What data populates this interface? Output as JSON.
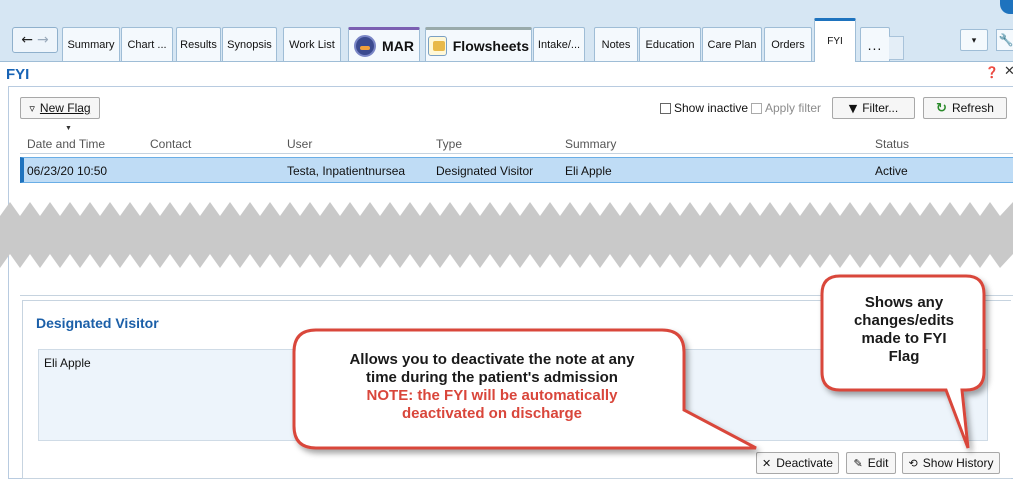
{
  "nav": {
    "back": "←",
    "forward": "→"
  },
  "tabs": [
    {
      "label": "Summary"
    },
    {
      "label": "Chart ..."
    },
    {
      "label": "Results"
    },
    {
      "label": "Synopsis"
    },
    {
      "label": "Work List"
    },
    {
      "label": "MAR",
      "icon": "mar-icon"
    },
    {
      "label": "Flowsheets",
      "icon": "flowsheets-icon"
    },
    {
      "label": "Intake/..."
    },
    {
      "label": "Notes"
    },
    {
      "label": "Education"
    },
    {
      "label": "Care Plan"
    },
    {
      "label": "Orders"
    },
    {
      "label": "FYI",
      "active": true
    },
    {
      "label": "..."
    }
  ],
  "tabbar_controls": {
    "dropdown": "▾",
    "wrench": "🔧"
  },
  "activity": {
    "title": "FYI",
    "help": "❓",
    "close": "✕"
  },
  "toolbar": {
    "new_flag": "New Flag",
    "show_inactive": "Show inactive",
    "apply_filter": "Apply filter",
    "filter": "Filter...",
    "refresh": "Refresh"
  },
  "grid": {
    "columns": [
      "Date and Time",
      "Contact",
      "User",
      "Type",
      "Summary",
      "Status"
    ],
    "rows": [
      {
        "date_time": "06/23/20 10:50",
        "contact": "",
        "user": "Testa, Inpatientnursea",
        "type": "Designated Visitor",
        "summary": "Eli Apple",
        "status": "Active"
      }
    ]
  },
  "details": {
    "title": "Designated Visitor",
    "body": "Eli Apple",
    "deactivate": "Deactivate",
    "edit": "Edit",
    "show_history": "Show History"
  },
  "callouts": {
    "deactivate_line1": "Allows you to deactivate the note at any",
    "deactivate_line2": "time during the patient's admission",
    "deactivate_note1": "NOTE: the FYI will be automatically",
    "deactivate_note2": "deactivated on discharge",
    "history_line1": "Shows any",
    "history_line2": "changes/edits",
    "history_line3": "made to FYI",
    "history_line4": "Flag"
  },
  "colors": {
    "accent": "#1e73be",
    "row_selected": "#bfdcf5",
    "callout_border": "#d9463b",
    "note_red": "#d9463b"
  }
}
